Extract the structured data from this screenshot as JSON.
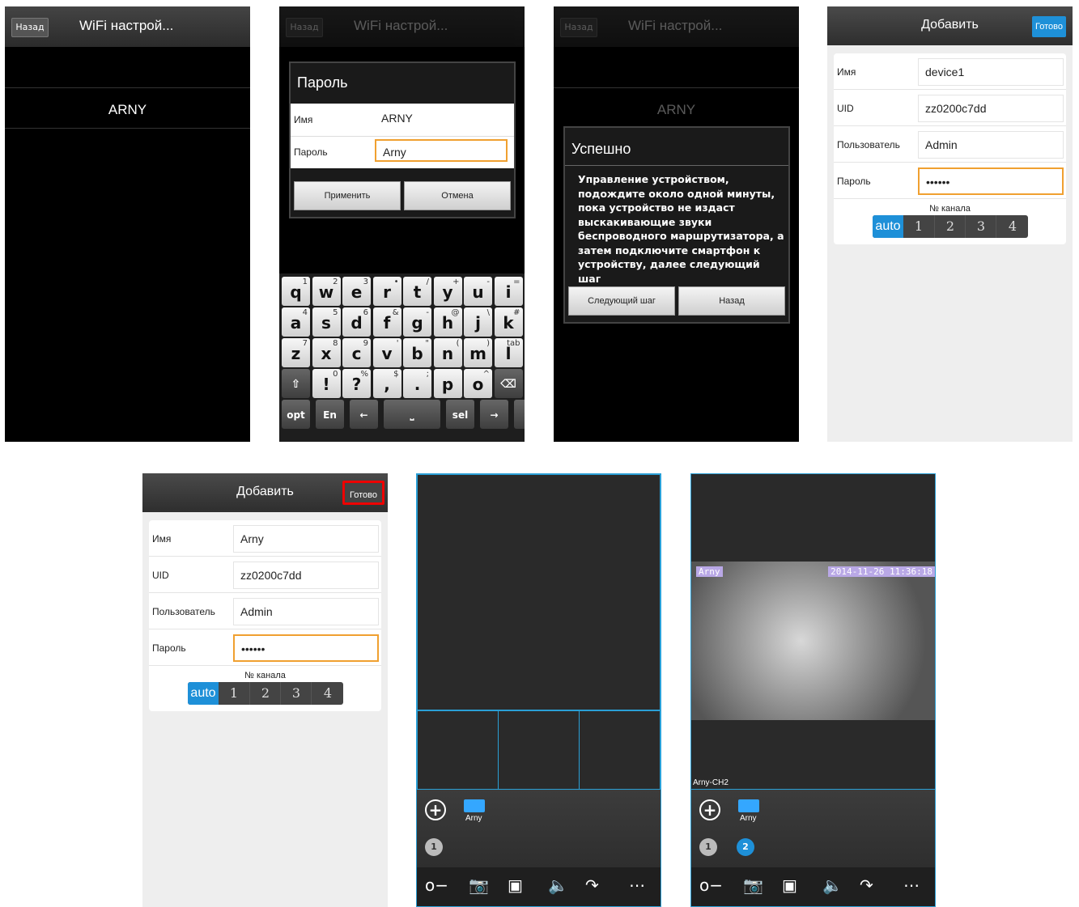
{
  "screen1": {
    "back_label": "Назад",
    "title": "WiFi настрой...",
    "network": "ARNY"
  },
  "screen2": {
    "back_label": "Назад",
    "title": "WiFi настрой...",
    "dialog_title": "Пароль",
    "name_label": "Имя",
    "name_value": "ARNY",
    "password_label": "Пароль",
    "password_value": "Arny",
    "apply_label": "Применить",
    "cancel_label": "Отмена",
    "keyboard": {
      "row1": [
        [
          "q",
          "1"
        ],
        [
          "w",
          "2"
        ],
        [
          "e",
          "3"
        ],
        [
          "r",
          "•"
        ],
        [
          "t",
          "/"
        ],
        [
          "y",
          "+"
        ],
        [
          "u",
          "-"
        ],
        [
          "i",
          "="
        ]
      ],
      "row2": [
        [
          "a",
          "4"
        ],
        [
          "s",
          "5"
        ],
        [
          "d",
          "6"
        ],
        [
          "f",
          "&"
        ],
        [
          "g",
          "-"
        ],
        [
          "h",
          "@"
        ],
        [
          "j",
          "\\"
        ],
        [
          "k",
          "#"
        ]
      ],
      "row3": [
        [
          "z",
          "7"
        ],
        [
          "x",
          "8"
        ],
        [
          "c",
          "9"
        ],
        [
          "v",
          "'"
        ],
        [
          "b",
          "\""
        ],
        [
          "n",
          "("
        ],
        [
          "m",
          ")"
        ],
        [
          "l",
          "tab"
        ]
      ],
      "row4": [
        "⇧",
        "!",
        "?",
        ",",
        ".",
        "p",
        "o",
        "⌫"
      ],
      "row4_sup": [
        "",
        "0",
        "%",
        "$",
        ";",
        "",
        "^",
        ""
      ],
      "row5": [
        "opt 123",
        "En",
        "←",
        "⎵",
        "sel",
        "→",
        "⏎"
      ]
    }
  },
  "screen3": {
    "back_label": "Назад",
    "title": "WiFi настрой...",
    "network": "ARNY",
    "dialog_title": "Успешно",
    "message": "Управление устройством, подождите около одной минуты, пока устройство не издаст выскакивающие звуки беспроводного маршрутизатора, а затем подключите смартфон к устройству, далее следующий шаг",
    "next_label": "Следующий шаг",
    "back_button_label": "Назад"
  },
  "screen4": {
    "title": "Добавить",
    "done_label": "Готово",
    "name_label": "Имя",
    "name_value": "device1",
    "uid_label": "UID",
    "uid_value": "zz0200c7dd",
    "user_label": "Пользователь",
    "user_value": "Admin",
    "password_label": "Пароль",
    "password_value": "••••••",
    "channel_label": "№ канала",
    "channels": [
      "auto",
      "1",
      "2",
      "3",
      "4"
    ]
  },
  "screen5": {
    "title": "Добавить",
    "done_label": "Готово",
    "name_label": "Имя",
    "name_value": "Arny",
    "uid_label": "UID",
    "uid_value": "zz0200c7dd",
    "user_label": "Пользователь",
    "user_value": "Admin",
    "password_label": "Пароль",
    "password_value": "••••••",
    "channel_label": "№ канала",
    "channels": [
      "auto",
      "1",
      "2",
      "3",
      "4"
    ]
  },
  "screen6": {
    "camera_label": "Arny",
    "channel_badge": "1"
  },
  "screen7": {
    "camera_label": "Arny",
    "overlay_name": "Arny",
    "overlay_timestamp": "2014-11-26 11:36:18",
    "stream_label": "Arny-CH2",
    "channel_badges": [
      "1",
      "2"
    ]
  },
  "colors": {
    "accent": "#1e90d8",
    "focus": "#f0a030",
    "highlight": "#e00000"
  }
}
